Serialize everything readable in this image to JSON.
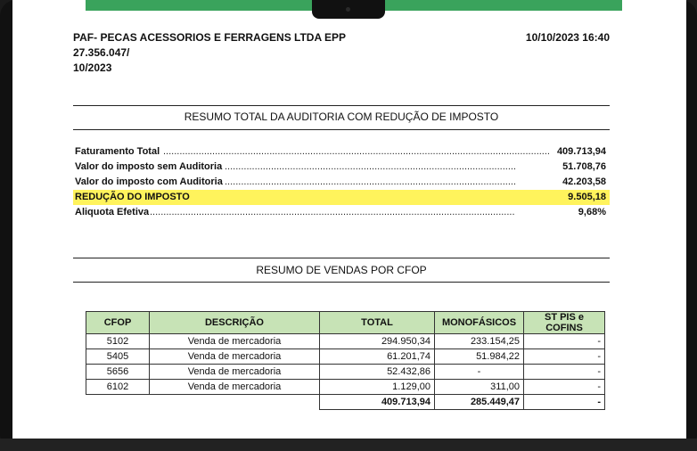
{
  "company": {
    "name": "PAF- PECAS ACESSORIOS E FERRAGENS LTDA EPP",
    "cnpj": "27.356.047/",
    "period": "10/2023",
    "datetime": "10/10/2023 16:40"
  },
  "summary": {
    "title": "RESUMO TOTAL DA AUDITORIA COM REDUÇÃO DE IMPOSTO",
    "rows": [
      {
        "label": "Faturamento Total",
        "value": "409.713,94"
      },
      {
        "label": "Valor do imposto sem Auditoria",
        "value": "51.708,76"
      },
      {
        "label": "Valor do imposto com Auditoria",
        "value": "42.203,58"
      },
      {
        "label": "REDUÇÃO DO IMPOSTO",
        "value": "9.505,18"
      },
      {
        "label": "Aliquota Efetiva",
        "value": "9,68%"
      }
    ]
  },
  "sales": {
    "title": "RESUMO DE VENDAS POR CFOP",
    "columns": [
      "CFOP",
      "DESCRIÇÃO",
      "TOTAL",
      "MONOFÁSICOS",
      "ST PIS e COFINS"
    ],
    "rows": [
      {
        "cfop": "5102",
        "desc": "Venda de mercadoria",
        "total": "294.950,34",
        "mono": "233.154,25",
        "st": "-"
      },
      {
        "cfop": "5405",
        "desc": "Venda de mercadoria",
        "total": "61.201,74",
        "mono": "51.984,22",
        "st": "-"
      },
      {
        "cfop": "5656",
        "desc": "Venda de mercadoria",
        "total": "52.432,86",
        "mono": "-",
        "st": "-"
      },
      {
        "cfop": "6102",
        "desc": "Venda de mercadoria",
        "total": "1.129,00",
        "mono": "311,00",
        "st": "-"
      }
    ],
    "totals": {
      "total": "409.713,94",
      "mono": "285.449,47",
      "st": "-"
    }
  },
  "colors": {
    "accent": "#3aa35c",
    "highlight": "#fff35c",
    "table_header": "#c7e3b6"
  }
}
